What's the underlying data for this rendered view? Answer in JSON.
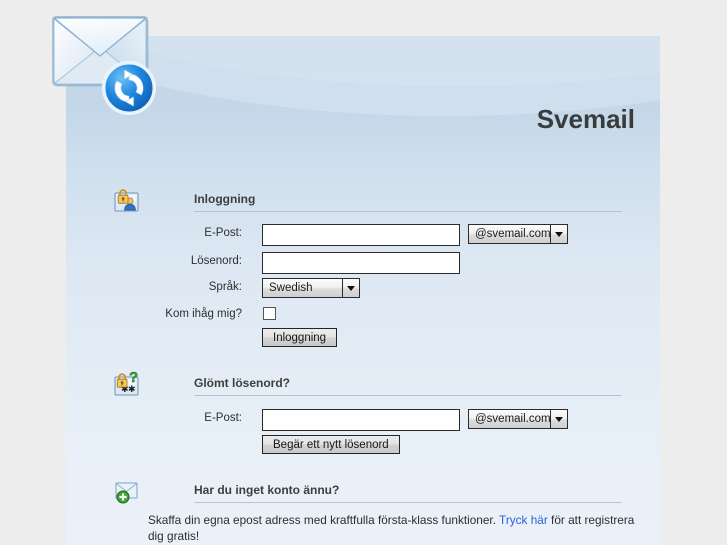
{
  "header": {
    "site_title": "Svemail",
    "logo_icon": "envelope-sync-icon"
  },
  "sections": {
    "login": {
      "icon": "lock-user-card-icon",
      "title": "Inloggning",
      "fields": {
        "email_label": "E-Post:",
        "email_value": "",
        "email_placeholder": "",
        "domain_value": "@svemail.com",
        "password_label": "Lösenord:",
        "password_value": "",
        "language_label": "Språk:",
        "language_value": "Swedish",
        "remember_label": "Kom ihåg mig?",
        "remember_checked": false
      },
      "submit_label": "Inloggning"
    },
    "forgot": {
      "icon": "lock-question-card-icon",
      "title": "Glömt lösenord?",
      "fields": {
        "email_label": "E-Post:",
        "email_value": "",
        "domain_value": "@svemail.com"
      },
      "submit_label": "Begär ett nytt lösenord"
    },
    "register": {
      "icon": "envelope-plus-icon",
      "title": "Har du inget konto ännu?",
      "text_before": "Skaffa din egna epost adress med kraftfulla första-klass funktioner. ",
      "link_label": "Tryck här",
      "text_after": " för att registrera dig gratis!"
    }
  },
  "colors": {
    "page_background": "#ededed",
    "panel_top": "#c2d6e8",
    "panel_bottom": "#eaf1f8",
    "link": "#2b5fd9",
    "rule": "#b4c4d4",
    "title_text": "#3b3b3b"
  }
}
